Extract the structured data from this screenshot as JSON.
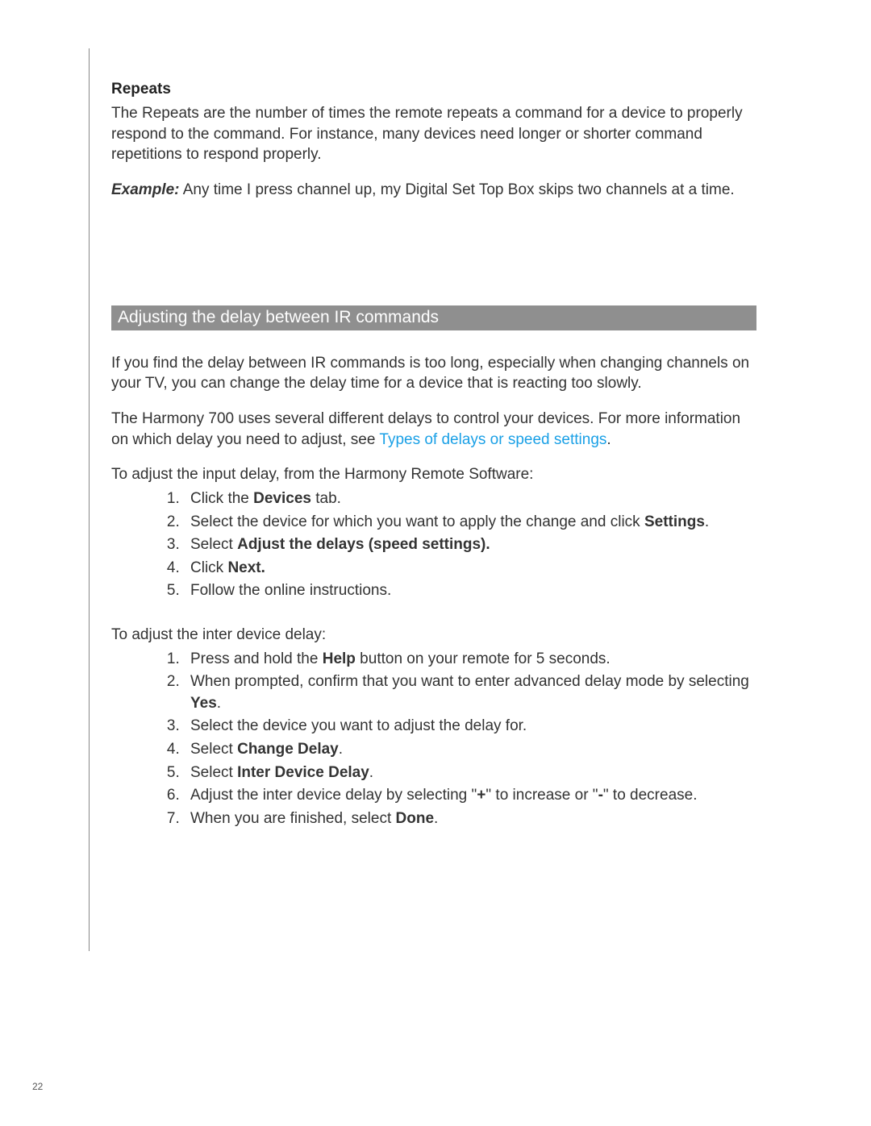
{
  "page_number": "22",
  "repeats": {
    "heading": "Repeats",
    "para": "The Repeats are the number of times the remote repeats a command for a device to properly respond to the command. For instance, many devices need longer or shorter command repetitions to respond properly.",
    "example_label": "Example:",
    "example_text": " Any time I press channel up, my Digital Set Top Box skips two channels at a time."
  },
  "section": {
    "title": "Adjusting the delay between IR commands",
    "para1": "If you find the delay between IR commands is too long, especially when changing channels on your TV, you can change the delay time for a device that is reacting too slowly.",
    "para2_pre": "The Harmony 700 uses several different delays to control your devices. For more information on which delay you need to adjust, see ",
    "para2_link": "Types of delays or speed settings",
    "para2_post": ".",
    "input_intro": "To adjust the input delay, from the Harmony Remote Software:",
    "input_steps": {
      "s1_a": "Click the ",
      "s1_b": "Devices",
      "s1_c": " tab.",
      "s2_a": "Select the device for which you want to apply the change and click ",
      "s2_b": "Settings",
      "s2_c": ".",
      "s3_a": "Select ",
      "s3_b": "Adjust the delays (speed settings).",
      "s4_a": "Click ",
      "s4_b": "Next.",
      "s5": "Follow the online instructions."
    },
    "inter_intro": "To adjust the inter device delay:",
    "inter_steps": {
      "s1_a": "Press and hold the ",
      "s1_b": "Help",
      "s1_c": " button on your remote for 5 seconds.",
      "s2_a": "When prompted, confirm that you want to enter advanced delay mode by selecting ",
      "s2_b": "Yes",
      "s2_c": ".",
      "s3": "Select the device you want to adjust the delay for.",
      "s4_a": "Select ",
      "s4_b": "Change Delay",
      "s4_c": ".",
      "s5_a": "Select ",
      "s5_b": "Inter Device Delay",
      "s5_c": ".",
      "s6_a": "Adjust the inter device delay by selecting \"",
      "s6_b": "+",
      "s6_c": "\" to increase or \"",
      "s6_d": "-",
      "s6_e": "\" to decrease.",
      "s7_a": "When you are finished, select ",
      "s7_b": "Done",
      "s7_c": "."
    }
  }
}
